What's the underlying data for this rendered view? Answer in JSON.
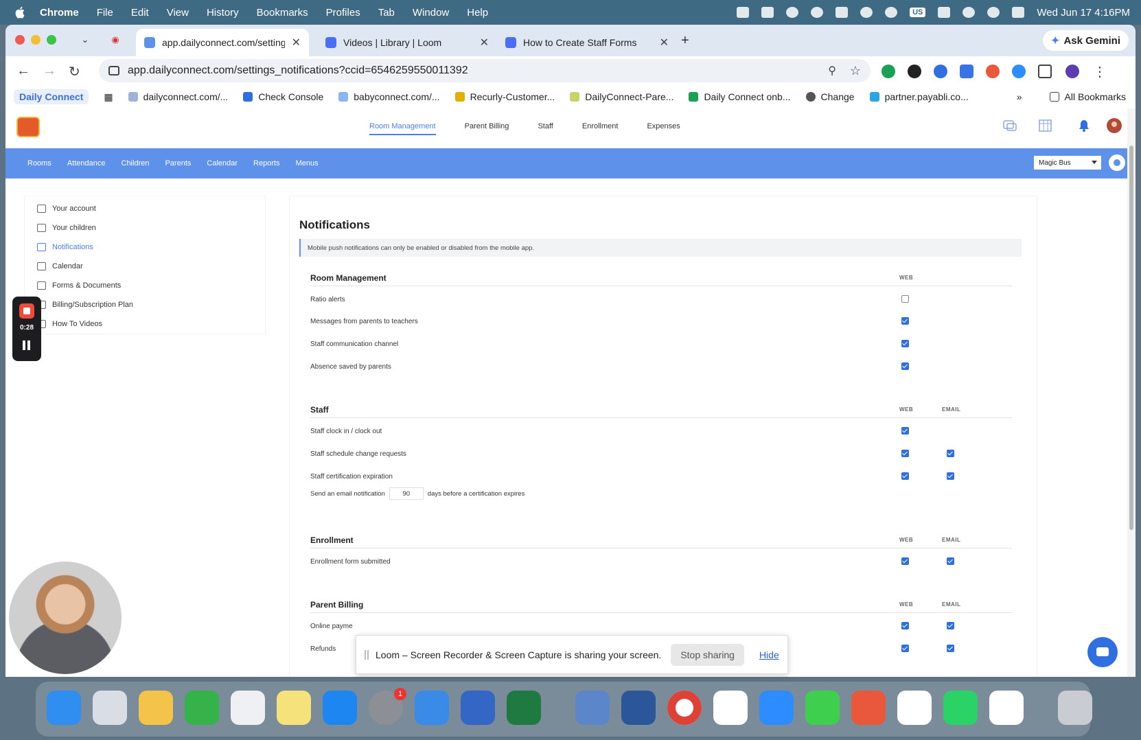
{
  "menubar": {
    "app": "Chrome",
    "items": [
      "File",
      "Edit",
      "View",
      "History",
      "Bookmarks",
      "Profiles",
      "Tab",
      "Window",
      "Help"
    ],
    "input_badge": "US",
    "clock": "Wed Jun 17  4:16PM"
  },
  "tabs": [
    {
      "label": "app.dailyconnect.com/setting",
      "color": "#5e92ea"
    },
    {
      "label": "Videos | Library | Loom",
      "color": "#4c6ef5"
    },
    {
      "label": "How to Create Staff Forms",
      "color": "#4c6ef5"
    }
  ],
  "gemini_label": "Ask Gemini",
  "url": "app.dailyconnect.com/settings_notifications?ccid=6546259550011392",
  "bookmarks": {
    "first": "Daily Connect",
    "items": [
      "dailyconnect.com/...",
      "Check Console",
      "babyconnect.com/...",
      "Recurly-Customer...",
      "DailyConnect-Pare...",
      "Daily Connect onb...",
      "Change",
      "partner.payabli.co..."
    ],
    "all": "All Bookmarks"
  },
  "app": {
    "topnav": [
      "Room Management",
      "Parent Billing",
      "Staff",
      "Enrollment",
      "Expenses"
    ],
    "subnav": [
      "Rooms",
      "Attendance",
      "Children",
      "Parents",
      "Calendar",
      "Reports",
      "Menus"
    ],
    "school": "Magic Bus",
    "sidebar": [
      "Your account",
      "Your children",
      "Notifications",
      "Calendar",
      "Forms & Documents",
      "Billing/Subscription Plan",
      "How To Videos"
    ],
    "panel": {
      "title": "Notifications",
      "info": "Mobile push notifications can only be enabled or disabled from the mobile app.",
      "col_web": "WEB",
      "col_email": "EMAIL",
      "sections": [
        {
          "title": "Room Management",
          "rows": [
            {
              "label": "Ratio alerts",
              "web": false
            },
            {
              "label": "Messages from parents to teachers",
              "web": true
            },
            {
              "label": "Staff communication channel",
              "web": true
            },
            {
              "label": "Absence saved by parents",
              "web": true
            }
          ]
        },
        {
          "title": "Staff",
          "rows": [
            {
              "label": "Staff clock in / clock out",
              "web": true
            },
            {
              "label": "Staff schedule change requests",
              "web": true,
              "email": true
            },
            {
              "label": "Staff certification expiration",
              "web": true,
              "email": true
            }
          ]
        },
        {
          "title": "Enrollment",
          "rows": [
            {
              "label": "Enrollment form submitted",
              "web": true,
              "email": true
            }
          ]
        },
        {
          "title": "Parent Billing",
          "rows": [
            {
              "label": "Online payme",
              "web": true,
              "email": true
            },
            {
              "label": "Refunds",
              "web": true,
              "email": true
            }
          ]
        }
      ],
      "cert_prefix": "Send an email notification",
      "cert_days": "90",
      "cert_suffix": "days before a certification expires"
    }
  },
  "recorder": {
    "time": "0:28"
  },
  "sharebar": {
    "message": "Loom – Screen Recorder & Screen Capture is sharing your screen.",
    "stop": "Stop sharing",
    "hide": "Hide"
  },
  "dock_badges": {
    "settings": "1"
  }
}
